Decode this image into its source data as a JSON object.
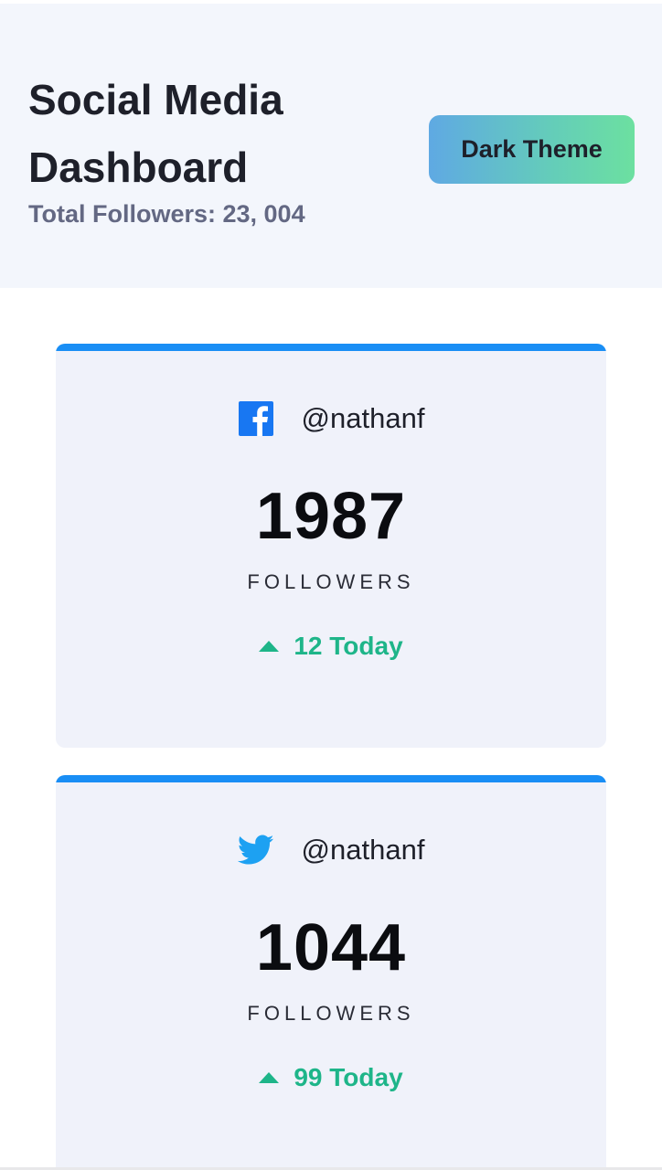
{
  "header": {
    "title": "Social Media Dashboard",
    "subtitle": "Total Followers: 23, 004",
    "theme_button_label": "Dark Theme"
  },
  "colors": {
    "accent_bar": "#198ef5",
    "positive": "#1eb589",
    "facebook_blue": "#1877f2",
    "twitter_blue": "#1da1f2"
  },
  "cards": [
    {
      "platform_icon": "facebook-icon",
      "handle": "@nathanf",
      "count": "1987",
      "count_label": "FOLLOWERS",
      "change": "12 Today",
      "change_direction": "up"
    },
    {
      "platform_icon": "twitter-icon",
      "handle": "@nathanf",
      "count": "1044",
      "count_label": "FOLLOWERS",
      "change": "99 Today",
      "change_direction": "up"
    }
  ]
}
